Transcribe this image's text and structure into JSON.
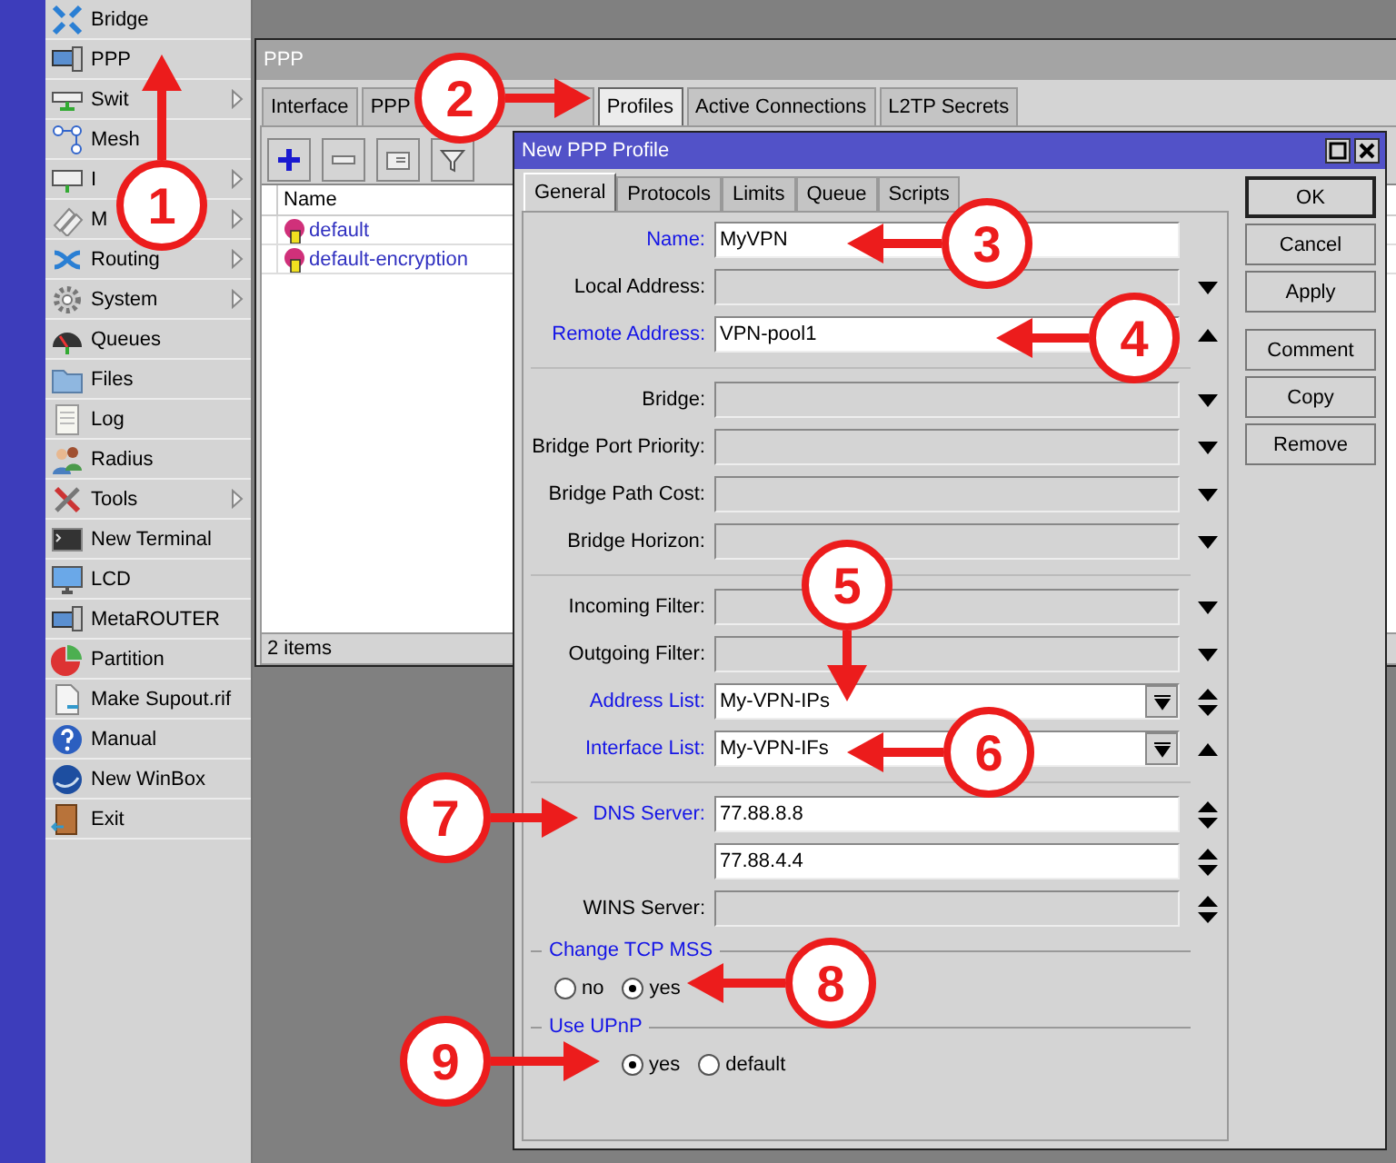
{
  "sidebar": {
    "items": [
      {
        "label": "Bridge",
        "submenu": false
      },
      {
        "label": "PPP",
        "submenu": false
      },
      {
        "label": "Swit",
        "submenu": true
      },
      {
        "label": "Mesh",
        "submenu": false
      },
      {
        "label": "I",
        "submenu": true
      },
      {
        "label": "M",
        "submenu": true
      },
      {
        "label": "Routing",
        "submenu": true
      },
      {
        "label": "System",
        "submenu": true
      },
      {
        "label": "Queues",
        "submenu": false
      },
      {
        "label": "Files",
        "submenu": false
      },
      {
        "label": "Log",
        "submenu": false
      },
      {
        "label": "Radius",
        "submenu": false
      },
      {
        "label": "Tools",
        "submenu": true
      },
      {
        "label": "New Terminal",
        "submenu": false
      },
      {
        "label": "LCD",
        "submenu": false
      },
      {
        "label": "MetaROUTER",
        "submenu": false
      },
      {
        "label": "Partition",
        "submenu": false
      },
      {
        "label": "Make Supout.rif",
        "submenu": false
      },
      {
        "label": "Manual",
        "submenu": false
      },
      {
        "label": "New WinBox",
        "submenu": false
      },
      {
        "label": "Exit",
        "submenu": false
      }
    ]
  },
  "ppp_window": {
    "title": "PPP",
    "tabs": [
      {
        "label": "Interface",
        "selected": false
      },
      {
        "label": "PPP",
        "selected": false
      },
      {
        "label": "Profiles",
        "selected": true
      },
      {
        "label": "Active Connections",
        "selected": false
      },
      {
        "label": "L2TP Secrets",
        "selected": false
      }
    ],
    "table": {
      "columns": [
        "Name"
      ],
      "rows": [
        {
          "name": "default"
        },
        {
          "name": "default-encryption"
        }
      ]
    },
    "status_bar": "2 items"
  },
  "dialog": {
    "title": "New PPP Profile",
    "tabs": [
      {
        "label": "General",
        "selected": true
      },
      {
        "label": "Protocols",
        "selected": false
      },
      {
        "label": "Limits",
        "selected": false
      },
      {
        "label": "Queue",
        "selected": false
      },
      {
        "label": "Scripts",
        "selected": false
      }
    ],
    "fields": [
      {
        "kind": "text",
        "label": "Name:",
        "emphasized": true,
        "value": "MyVPN"
      },
      {
        "kind": "empty",
        "label": "Local Address:",
        "emphasized": false,
        "expanded": false
      },
      {
        "kind": "text",
        "label": "Remote Address:",
        "emphasized": true,
        "value": "VPN-pool1",
        "expanded": true
      },
      {
        "kind": "separator"
      },
      {
        "kind": "empty",
        "label": "Bridge:",
        "emphasized": false,
        "expanded": false
      },
      {
        "kind": "empty",
        "label": "Bridge Port Priority:",
        "emphasized": false,
        "expanded": false
      },
      {
        "kind": "empty",
        "label": "Bridge Path Cost:",
        "emphasized": false,
        "expanded": false
      },
      {
        "kind": "empty",
        "label": "Bridge Horizon:",
        "emphasized": false,
        "expanded": false
      },
      {
        "kind": "separator"
      },
      {
        "kind": "empty",
        "label": "Incoming Filter:",
        "emphasized": false,
        "expanded": false
      },
      {
        "kind": "empty",
        "label": "Outgoing Filter:",
        "emphasized": false,
        "expanded": false
      },
      {
        "kind": "list",
        "label": "Address List:",
        "emphasized": true,
        "value": "My-VPN-IPs",
        "spinner": true
      },
      {
        "kind": "list",
        "label": "Interface List:",
        "emphasized": true,
        "value": "My-VPN-IFs",
        "expanded": true
      },
      {
        "kind": "separator"
      },
      {
        "kind": "text",
        "label": "DNS Server:",
        "emphasized": true,
        "value": "77.88.8.8",
        "spinner": true
      },
      {
        "kind": "text",
        "value": "77.88.4.4",
        "spinner": true
      },
      {
        "kind": "empty",
        "label": "WINS Server:",
        "emphasized": false,
        "spinner": true
      }
    ],
    "groups": [
      {
        "title": "Change TCP MSS",
        "options": [
          {
            "label": "no",
            "selected": false
          },
          {
            "label": "yes",
            "selected": true
          }
        ]
      },
      {
        "title": "Use UPnP",
        "options": [
          {
            "label": "yes",
            "selected": true
          },
          {
            "label": "default",
            "selected": false
          }
        ]
      }
    ],
    "button_groups": [
      {
        "buttons": [
          {
            "label": "OK",
            "default": true
          },
          {
            "label": "Cancel",
            "default": false
          },
          {
            "label": "Apply",
            "default": false
          }
        ]
      },
      {
        "buttons": [
          {
            "label": "Comment",
            "default": false
          },
          {
            "label": "Copy",
            "default": false
          },
          {
            "label": "Remove",
            "default": false
          }
        ]
      }
    ]
  },
  "callouts": [
    {
      "number": "1"
    },
    {
      "number": "2"
    },
    {
      "number": "3"
    },
    {
      "number": "4"
    },
    {
      "number": "5"
    },
    {
      "number": "6"
    },
    {
      "number": "7"
    },
    {
      "number": "8"
    },
    {
      "number": "9"
    }
  ]
}
